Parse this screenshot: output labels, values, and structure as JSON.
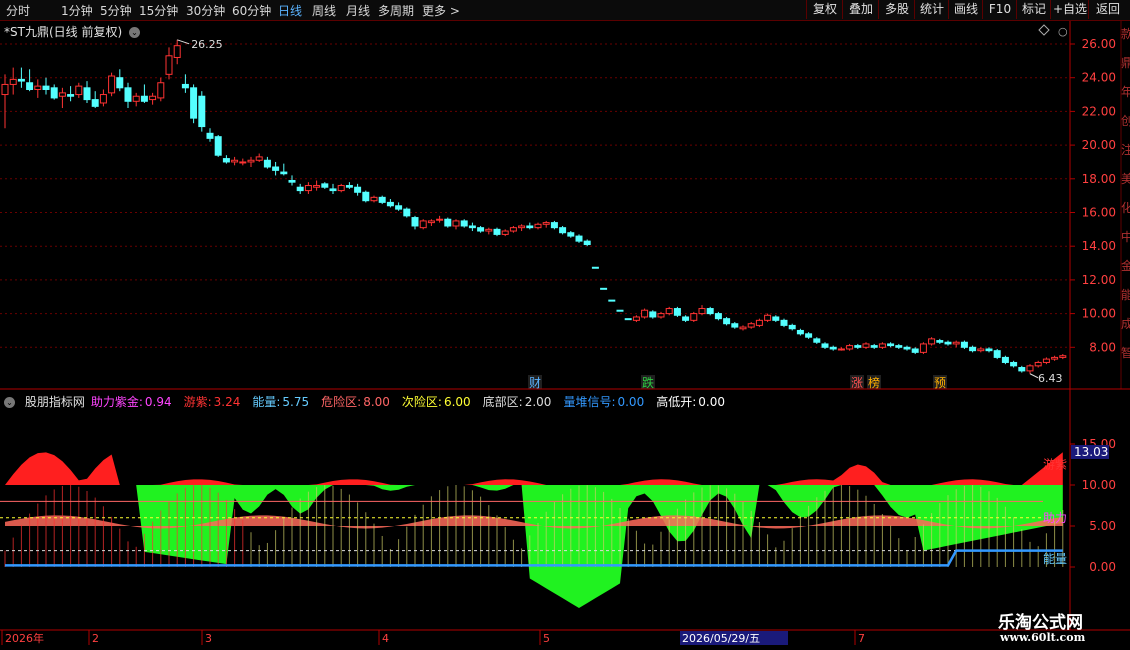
{
  "toolbar": {
    "periods": [
      "分时",
      "1分钟",
      "5分钟",
      "15分钟",
      "30分钟",
      "60分钟",
      "日线",
      "周线",
      "月线",
      "多周期",
      "更多 >"
    ],
    "active_period": "日线",
    "tools": [
      "复权",
      "叠加",
      "多股",
      "统计",
      "画线",
      "F10",
      "标记",
      "+自选",
      "返回"
    ]
  },
  "stock": {
    "title": "*ST九鼎(日线 前复权)",
    "high_label": "26.25",
    "low_label": "6.43",
    "event_marks": [
      {
        "text": "财",
        "color": "#5ab3ff"
      },
      {
        "text": "跌",
        "color": "#2ecc40"
      },
      {
        "text": "涨",
        "color": "#ff5050"
      },
      {
        "text": "榜",
        "color": "#ffb000"
      },
      {
        "text": "预",
        "color": "#ffb000"
      }
    ]
  },
  "price_axis": {
    "ticks": [
      "26.00",
      "24.00",
      "22.00",
      "20.00",
      "18.00",
      "16.00",
      "14.00",
      "12.00",
      "10.00",
      "8.00"
    ],
    "tick_values": [
      26,
      24,
      22,
      20,
      18,
      16,
      14,
      12,
      10,
      8
    ],
    "right_side_text": [
      "款",
      "鼎",
      "年",
      "创",
      "注",
      "美",
      "化",
      "中",
      "金",
      "能",
      "成",
      "智"
    ]
  },
  "indicator": {
    "name": "股朋指标网",
    "items": [
      {
        "label": "助力紫金:",
        "value": "0.94",
        "color": "#ff44ff"
      },
      {
        "label": "游紫:",
        "value": "3.24",
        "color": "#ff3333"
      },
      {
        "label": "能量:",
        "value": "5.75",
        "color": "#66ccff"
      },
      {
        "label": "危险区:",
        "value": "8.00",
        "color": "#ff6666"
      },
      {
        "label": "次险区:",
        "value": "6.00",
        "color": "#ffff33"
      },
      {
        "label": "底部区:",
        "value": "2.00",
        "color": "#dddddd"
      },
      {
        "label": "量堆信号:",
        "value": "0.00",
        "color": "#3399ff"
      },
      {
        "label": "高低开:",
        "value": "0.00",
        "color": "#ffffff"
      }
    ],
    "axis_ticks": [
      "15.00",
      "10.00",
      "5.00",
      "0.00"
    ],
    "axis_tick_values": [
      15,
      10,
      5,
      0
    ],
    "current_value": "13.03",
    "right_labels": [
      {
        "text": "游紫",
        "color": "#ff3333"
      },
      {
        "text": "助力",
        "color": "#ff44ff"
      },
      {
        "text": "能量",
        "color": "#66ccff"
      }
    ]
  },
  "date_axis": {
    "labels": [
      "2026年",
      "2",
      "3",
      "4",
      "5",
      "7"
    ],
    "cursor_date": "2026/05/29/五"
  },
  "watermark": {
    "title": "乐淘公式网",
    "url": "www.60lt.com"
  },
  "colors": {
    "up": "#ff3333",
    "down": "#54ffff",
    "grid": "#6a0000",
    "accent_bg": "#1a1a7a"
  },
  "candles": [
    [
      23.0,
      24.2,
      21.0,
      23.6
    ],
    [
      23.6,
      24.6,
      23.0,
      23.9
    ],
    [
      23.9,
      24.6,
      23.4,
      23.8
    ],
    [
      23.7,
      24.5,
      23.2,
      23.3
    ],
    [
      23.3,
      23.9,
      22.8,
      23.5
    ],
    [
      23.5,
      24.0,
      23.0,
      23.3
    ],
    [
      23.4,
      23.6,
      22.7,
      22.8
    ],
    [
      22.9,
      23.4,
      22.2,
      23.1
    ],
    [
      23.0,
      23.5,
      22.6,
      22.9
    ],
    [
      23.0,
      23.7,
      22.8,
      23.5
    ],
    [
      23.4,
      23.8,
      22.5,
      22.7
    ],
    [
      22.7,
      23.2,
      22.2,
      22.3
    ],
    [
      22.5,
      23.3,
      22.3,
      23.0
    ],
    [
      23.1,
      24.3,
      22.9,
      24.1
    ],
    [
      24.0,
      24.5,
      23.2,
      23.4
    ],
    [
      23.4,
      23.7,
      22.2,
      22.6
    ],
    [
      22.6,
      23.1,
      22.3,
      22.9
    ],
    [
      22.9,
      23.6,
      22.5,
      22.6
    ],
    [
      22.7,
      23.1,
      22.4,
      22.9
    ],
    [
      22.8,
      24.0,
      22.6,
      23.7
    ],
    [
      24.2,
      25.8,
      23.9,
      25.3
    ],
    [
      25.2,
      26.25,
      24.8,
      25.9
    ],
    [
      23.6,
      24.2,
      23.1,
      23.4
    ],
    [
      23.4,
      23.6,
      21.3,
      21.6
    ],
    [
      22.9,
      23.2,
      20.8,
      21.1
    ],
    [
      20.7,
      21.0,
      20.2,
      20.4
    ],
    [
      20.5,
      20.6,
      19.3,
      19.4
    ],
    [
      19.2,
      19.4,
      18.9,
      19.0
    ],
    [
      19.0,
      19.3,
      18.8,
      19.1
    ],
    [
      19.0,
      19.2,
      18.8,
      19.0
    ],
    [
      19.0,
      19.3,
      18.7,
      19.1
    ],
    [
      19.1,
      19.5,
      19.0,
      19.3
    ],
    [
      19.1,
      19.3,
      18.6,
      18.7
    ],
    [
      18.7,
      19.0,
      18.2,
      18.5
    ],
    [
      18.4,
      18.9,
      18.2,
      18.3
    ],
    [
      17.9,
      18.2,
      17.6,
      17.8
    ],
    [
      17.5,
      17.7,
      17.1,
      17.3
    ],
    [
      17.3,
      17.8,
      17.1,
      17.6
    ],
    [
      17.5,
      17.9,
      17.3,
      17.6
    ],
    [
      17.7,
      17.8,
      17.4,
      17.5
    ],
    [
      17.4,
      17.7,
      17.1,
      17.3
    ],
    [
      17.3,
      17.7,
      17.2,
      17.6
    ],
    [
      17.6,
      17.8,
      17.4,
      17.5
    ],
    [
      17.5,
      17.7,
      17.0,
      17.2
    ],
    [
      17.2,
      17.3,
      16.6,
      16.7
    ],
    [
      16.7,
      17.0,
      16.6,
      16.9
    ],
    [
      16.9,
      17.0,
      16.5,
      16.6
    ],
    [
      16.6,
      16.8,
      16.3,
      16.4
    ],
    [
      16.4,
      16.6,
      16.1,
      16.2
    ],
    [
      16.2,
      16.3,
      15.7,
      15.8
    ],
    [
      15.7,
      15.8,
      15.0,
      15.2
    ],
    [
      15.1,
      15.6,
      15.0,
      15.5
    ],
    [
      15.4,
      15.6,
      15.2,
      15.5
    ],
    [
      15.6,
      15.8,
      15.4,
      15.6
    ],
    [
      15.6,
      15.7,
      15.1,
      15.2
    ],
    [
      15.2,
      15.6,
      15.0,
      15.5
    ],
    [
      15.5,
      15.6,
      15.1,
      15.2
    ],
    [
      15.2,
      15.4,
      14.9,
      15.1
    ],
    [
      15.1,
      15.2,
      14.8,
      14.9
    ],
    [
      14.9,
      15.1,
      14.7,
      15.0
    ],
    [
      15.0,
      15.1,
      14.6,
      14.7
    ],
    [
      14.7,
      15.0,
      14.6,
      14.9
    ],
    [
      14.9,
      15.2,
      14.8,
      15.1
    ],
    [
      15.1,
      15.3,
      14.9,
      15.2
    ],
    [
      15.2,
      15.4,
      15.0,
      15.1
    ],
    [
      15.1,
      15.4,
      15.0,
      15.3
    ],
    [
      15.3,
      15.5,
      15.1,
      15.4
    ],
    [
      15.4,
      15.5,
      15.0,
      15.1
    ],
    [
      15.1,
      15.2,
      14.7,
      14.8
    ],
    [
      14.8,
      14.9,
      14.5,
      14.6
    ],
    [
      14.6,
      14.7,
      14.2,
      14.3
    ],
    [
      14.3,
      14.4,
      14.0,
      14.1
    ],
    [
      12.75,
      12.75,
      12.7,
      12.71
    ],
    [
      11.5,
      11.5,
      11.45,
      11.46
    ],
    [
      10.8,
      10.8,
      10.75,
      10.76
    ],
    [
      10.2,
      10.2,
      10.15,
      10.16
    ],
    [
      9.7,
      9.7,
      9.65,
      9.66
    ],
    [
      9.6,
      9.9,
      9.5,
      9.8
    ],
    [
      9.8,
      10.3,
      9.7,
      10.2
    ],
    [
      10.1,
      10.2,
      9.7,
      9.8
    ],
    [
      9.8,
      10.1,
      9.7,
      10.0
    ],
    [
      10.0,
      10.4,
      9.9,
      10.3
    ],
    [
      10.3,
      10.4,
      9.8,
      9.9
    ],
    [
      9.8,
      9.9,
      9.5,
      9.6
    ],
    [
      9.6,
      10.1,
      9.5,
      10.0
    ],
    [
      10.0,
      10.5,
      9.9,
      10.3
    ],
    [
      10.3,
      10.4,
      9.9,
      10.0
    ],
    [
      10.0,
      10.1,
      9.6,
      9.7
    ],
    [
      9.7,
      9.8,
      9.3,
      9.4
    ],
    [
      9.4,
      9.5,
      9.1,
      9.2
    ],
    [
      9.1,
      9.3,
      9.0,
      9.2
    ],
    [
      9.2,
      9.5,
      9.1,
      9.4
    ],
    [
      9.3,
      9.7,
      9.2,
      9.6
    ],
    [
      9.6,
      10.0,
      9.5,
      9.9
    ],
    [
      9.8,
      9.9,
      9.5,
      9.6
    ],
    [
      9.6,
      9.7,
      9.2,
      9.3
    ],
    [
      9.3,
      9.4,
      9.0,
      9.1
    ],
    [
      9.0,
      9.1,
      8.7,
      8.8
    ],
    [
      8.8,
      8.9,
      8.5,
      8.6
    ],
    [
      8.5,
      8.6,
      8.2,
      8.3
    ],
    [
      8.2,
      8.3,
      7.9,
      8.0
    ],
    [
      8.0,
      8.1,
      7.8,
      7.9
    ],
    [
      7.9,
      8.0,
      7.8,
      7.9
    ],
    [
      7.9,
      8.2,
      7.8,
      8.1
    ],
    [
      8.1,
      8.2,
      7.9,
      8.0
    ],
    [
      8.0,
      8.3,
      7.9,
      8.2
    ],
    [
      8.1,
      8.2,
      7.9,
      8.0
    ],
    [
      8.0,
      8.3,
      7.9,
      8.2
    ],
    [
      8.2,
      8.3,
      8.0,
      8.1
    ],
    [
      8.1,
      8.2,
      7.9,
      8.0
    ],
    [
      8.0,
      8.1,
      7.8,
      7.9
    ],
    [
      7.9,
      8.0,
      7.6,
      7.7
    ],
    [
      7.7,
      8.3,
      7.6,
      8.2
    ],
    [
      8.2,
      8.6,
      8.1,
      8.5
    ],
    [
      8.4,
      8.5,
      8.2,
      8.3
    ],
    [
      8.3,
      8.4,
      8.1,
      8.2
    ],
    [
      8.2,
      8.4,
      8.0,
      8.3
    ],
    [
      8.3,
      8.4,
      7.9,
      8.0
    ],
    [
      8.0,
      8.1,
      7.7,
      7.8
    ],
    [
      7.8,
      8.0,
      7.7,
      7.9
    ],
    [
      7.9,
      8.0,
      7.7,
      7.8
    ],
    [
      7.8,
      7.9,
      7.3,
      7.4
    ],
    [
      7.4,
      7.5,
      7.0,
      7.1
    ],
    [
      7.1,
      7.2,
      6.8,
      6.9
    ],
    [
      6.8,
      6.9,
      6.5,
      6.6
    ],
    [
      6.6,
      7.0,
      6.43,
      6.9
    ],
    [
      6.9,
      7.2,
      6.8,
      7.1
    ],
    [
      7.1,
      7.4,
      7.0,
      7.3
    ],
    [
      7.3,
      7.5,
      7.2,
      7.4
    ],
    [
      7.4,
      7.6,
      7.3,
      7.5
    ]
  ]
}
